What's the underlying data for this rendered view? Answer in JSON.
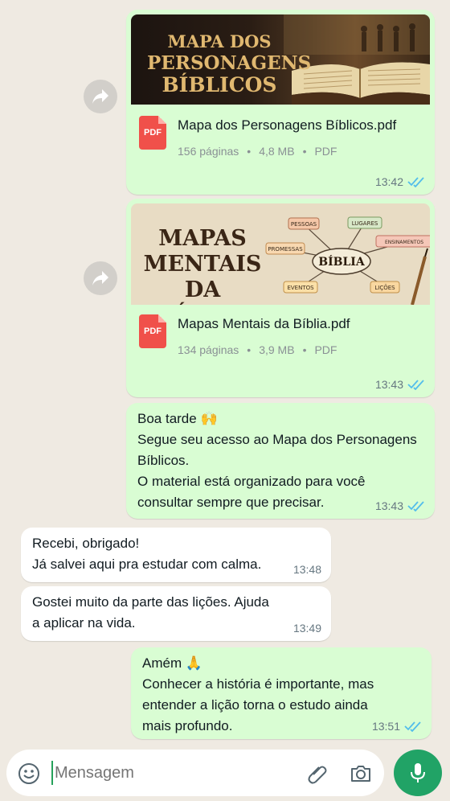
{
  "documents": [
    {
      "thumb_title": [
        "MAPA DOS",
        "PERSONAGENS",
        "BÍBLICOS"
      ],
      "pdf_label": "PDF",
      "name": "Mapa dos Personagens Bíblicos.pdf",
      "pages": "156 páginas",
      "size": "4,8 MB",
      "type": "PDF",
      "time": "13:42"
    },
    {
      "thumb_title": [
        "MAPAS",
        "MENTAIS",
        "DA BÍBLIA"
      ],
      "mindmap": {
        "center": "BÍBLIA",
        "nodes": [
          "PESSOAS",
          "LUGARES",
          "PROMESSAS",
          "ENSINAMENTOS",
          "EVENTOS",
          "LIÇÕES"
        ]
      },
      "pdf_label": "PDF",
      "name": "Mapas Mentais da Bíblia.pdf",
      "pages": "134 páginas",
      "size": "3,9 MB",
      "type": "PDF",
      "time": "13:43"
    }
  ],
  "messages": [
    {
      "dir": "out",
      "lines": [
        "Boa tarde 🙌",
        "Segue seu acesso ao Mapa dos Personagens",
        "Bíblicos.",
        "O material está organizado para você",
        "consultar sempre que precisar."
      ],
      "time": "13:43"
    },
    {
      "dir": "in",
      "lines": [
        "Recebi, obrigado!",
        "Já salvei aqui pra estudar com calma."
      ],
      "time": "13:48"
    },
    {
      "dir": "in",
      "lines": [
        "Gostei muito da parte das lições. Ajuda",
        "a aplicar na vida."
      ],
      "time": "13:49"
    },
    {
      "dir": "out",
      "lines": [
        "Amém 🙏",
        "Conhecer a história é importante, mas",
        "entender a lição torna o estudo ainda",
        "mais profundo."
      ],
      "time": "13:51"
    }
  ],
  "input": {
    "placeholder": "Mensagem"
  },
  "colors": {
    "outgoing_bubble": "#d9fdd3",
    "incoming_bubble": "#ffffff",
    "background": "#efeae2",
    "read_ticks": "#53bdeb",
    "mic_button": "#21a366",
    "pdf_icon": "#f0504a"
  },
  "icons": [
    "forward-icon",
    "pdf-icon",
    "double-check-icon",
    "emoji-icon",
    "attach-icon",
    "camera-icon",
    "mic-icon"
  ]
}
